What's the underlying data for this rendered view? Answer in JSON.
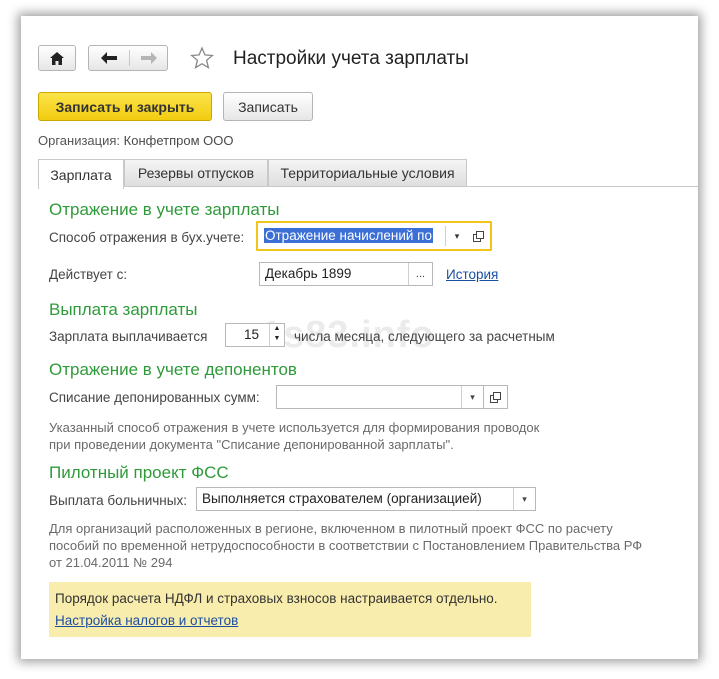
{
  "header": {
    "title": "Настройки учета зарплаты",
    "home_icon": "home-icon",
    "back_icon": "arrow-left-icon",
    "forward_icon": "arrow-right-icon",
    "favorite_icon": "star-icon"
  },
  "toolbar": {
    "save_close_label": "Записать и закрыть",
    "save_label": "Записать"
  },
  "organization": {
    "label": "Организация:",
    "value": "Конфетпром ООО"
  },
  "tabs": [
    {
      "label": "Зарплата",
      "active": true
    },
    {
      "label": "Резервы отпусков",
      "active": false
    },
    {
      "label": "Территориальные условия",
      "active": false
    }
  ],
  "salary_accounting": {
    "section_title": "Отражение в учете зарплаты",
    "method_label": "Способ отражения в бух.учете:",
    "method_value": "Отражение начислений по",
    "effective_label": "Действует с:",
    "effective_value": "Декабрь 1899",
    "select_button": "...",
    "history_link": "История"
  },
  "payout": {
    "section_title": "Выплата зарплаты",
    "label": "Зарплата выплачивается",
    "day_value": "15",
    "suffix": "числа месяца, следующего за расчетным"
  },
  "deponents": {
    "section_title": "Отражение в учете депонентов",
    "label": "Списание депонированных сумм:",
    "value": "",
    "note_line1": "Указанный способ отражения в учете используется для формирования проводок",
    "note_line2": "при проведении документа \"Списание депонированной зарплаты\"."
  },
  "fss": {
    "section_title": "Пилотный проект ФСС",
    "label": "Выплата больничных:",
    "value": "Выполняется страхователем (организацией)",
    "note_line1": "Для организаций расположенных в регионе, включенном в пилотный проект ФСС по расчету",
    "note_line2": "пособий по временной нетрудоспособности в соответствии с Постановлением Правительства РФ",
    "note_line3": "от 21.04.2011 № 294"
  },
  "tax_notice": {
    "text": "Порядок расчета НДФЛ и страховых взносов настраивается отдельно.",
    "link": "Настройка налогов и отчетов"
  },
  "watermark": "1s83.info",
  "colors": {
    "section_green": "#2f9a3a",
    "link_blue": "#1b4fa0",
    "primary_yellow": "#f5d21f",
    "focus_border": "#f0c419",
    "selection_blue": "#3b6fd6",
    "notice_bg": "#f9edae"
  }
}
